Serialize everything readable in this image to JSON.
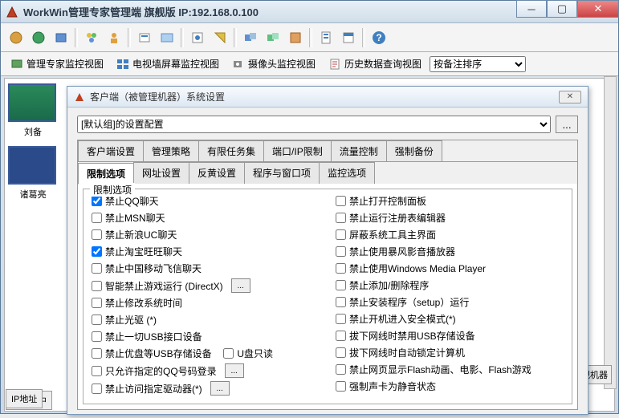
{
  "window": {
    "title": "WorkWin管理专家管理端   旗舰版 IP:192.168.0.100"
  },
  "viewbar": {
    "v1": "管理专家监控视图",
    "v2": "电视墙屏幕监控视图",
    "v3": "摄像头监控视图",
    "v4": "历史数据查询视图",
    "sort_label": "按备注排序"
  },
  "thumbs": {
    "t1": "刘备",
    "t2": "诸葛亮"
  },
  "dialog": {
    "title": "客户端（被管理机器）系统设置",
    "config_select": "[默认组]的设置配置",
    "more_btn": "...",
    "tabs_row1": {
      "t1": "客户端设置",
      "t2": "管理策略",
      "t3": "有限任务集",
      "t4": "端口/IP限制",
      "t5": "流量控制",
      "t6": "强制备份"
    },
    "tabs_row2": {
      "t1": "限制选项",
      "t2": "网址设置",
      "t3": "反黄设置",
      "t4": "程序与窗口项",
      "t5": "监控选项"
    },
    "group_title": "限制选项",
    "left": {
      "c1": "禁止QQ聊天",
      "c2": "禁止MSN聊天",
      "c3": "禁止新浪UC聊天",
      "c4": "禁止淘宝旺旺聊天",
      "c5": "禁止中国移动飞信聊天",
      "c6": "智能禁止游戏运行 (DirectX)",
      "c7": "禁止修改系统时间",
      "c8": "禁止光驱 (*)",
      "c9": "禁止一切USB接口设备",
      "c10": "禁止优盘等USB存储设备",
      "c10b": "U盘只读",
      "c11": "只允许指定的QQ号码登录",
      "c12": "禁止访问指定驱动器(*)"
    },
    "right": {
      "c1": "禁止打开控制面板",
      "c2": "禁止运行注册表编辑器",
      "c3": "屏蔽系统工具主界面",
      "c4": "禁止使用暴风影音播放器",
      "c5": "禁止使用Windows Media Player",
      "c6": "禁止添加/删除程序",
      "c7": "禁止安装程序（setup）运行",
      "c8": "禁止开机进入安全模式(*)",
      "c9": "拔下网线时禁用USB存储设备",
      "c10": "拔下网线时自动锁定计算机",
      "c11": "禁止网页显示Flash动画、电影、Flash游戏",
      "c12": "强制声卡为静音状态"
    }
  },
  "bottom": {
    "b1": "局域网中",
    "b2": "IP地址",
    "b3": "监视机器"
  }
}
